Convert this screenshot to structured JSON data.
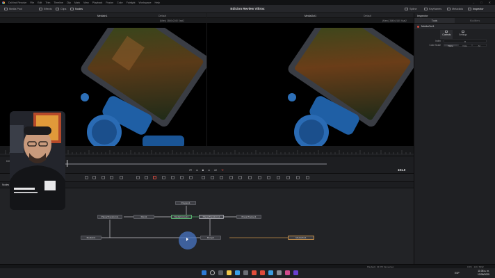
{
  "menubar": {
    "items": [
      "DaVinci Resolve",
      "File",
      "Edit",
      "Trim",
      "Timeline",
      "Clip",
      "Mark",
      "View",
      "Playback",
      "Fusion",
      "Color",
      "Fairlight",
      "Workspace",
      "Help"
    ],
    "window_controls": [
      "–",
      "□",
      "✕"
    ]
  },
  "toolbar": {
    "left_buttons": [
      "Media Pool",
      "Effects",
      "Clips",
      "Nodes"
    ],
    "title": "Edicion Review Viltrox",
    "right_buttons": [
      "Spline",
      "Keyframes",
      "Metadata",
      "Inspector"
    ]
  },
  "viewers": {
    "left": {
      "name": "MediaIn1",
      "option": "Default",
      "info": "(Merc) 3840x2160 Xsat2"
    },
    "right": {
      "name": "MediaOut1",
      "option": "Default",
      "info": "(Merc) 3840x2160 Xsat2"
    }
  },
  "timeline": {
    "start_frame": "0.0",
    "current_frame": "101.0"
  },
  "nodes_panel": {
    "title": "Nodes"
  },
  "nodes": [
    {
      "label": "Polygon1"
    },
    {
      "label": "PlanarTransform1"
    },
    {
      "label": "Paint1"
    },
    {
      "label": "MediaCorrect1"
    },
    {
      "label": "PlanarTransform1"
    },
    {
      "label": "PlanarTracker1"
    },
    {
      "label": "MediaIn1"
    },
    {
      "label": "Merge1"
    },
    {
      "label": "MediaOut1"
    }
  ],
  "inspector": {
    "title": "Inspector",
    "tab_tools": "Tools",
    "tab_modifiers": "Modifiers",
    "node_name": "MediaOut1",
    "subtabs": [
      "Controls",
      "Settings"
    ],
    "rows": [
      {
        "label": "Index",
        "value": "0"
      }
    ],
    "color_mode_label": "Color Scale",
    "color_mode_options": [
      "None",
      "Data",
      "All"
    ],
    "color_mode_selected": "None"
  },
  "statusbar": {
    "center": "Playback: 23.976 frames/sec",
    "right": "0.0% · 124 / 8192"
  },
  "taskbar": {
    "tray_lang": "ESP",
    "time": "11:08 a. m.",
    "date": "12/08/2025"
  },
  "colors": {
    "accent_red": "#d04a3f",
    "node_link_green": "#58b46f",
    "node_link_orange": "#c9924a",
    "cursor_blue": "#4876c4"
  }
}
